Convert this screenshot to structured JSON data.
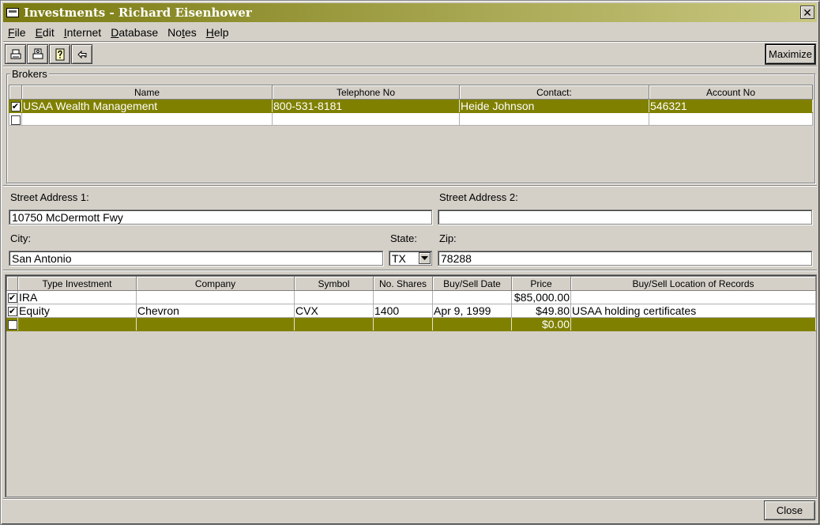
{
  "window": {
    "title": "Investments - Richard Eisenhower",
    "close_glyph": "✕"
  },
  "menu": [
    {
      "first": "F",
      "rest": "ile"
    },
    {
      "first": "E",
      "rest": "dit"
    },
    {
      "first": "I",
      "rest": "nternet"
    },
    {
      "first": "D",
      "rest": "atabase"
    },
    {
      "pre": "No",
      "first": "t",
      "rest": "es"
    },
    {
      "first": "H",
      "rest": "elp"
    }
  ],
  "toolbar": {
    "icons": [
      "print-icon",
      "print-preview-icon",
      "help-icon",
      "back-arrow-icon"
    ],
    "maximize_label": "Maximize"
  },
  "brokers": {
    "group_label": "Brokers",
    "columns": [
      "Name",
      "Telephone No",
      "Contact:",
      "Account No"
    ],
    "rows": [
      {
        "checked": "✔",
        "name": "USAA Wealth Management",
        "phone": "800-531-8181",
        "contact": "Heide Johnson",
        "account": "546321"
      },
      {
        "checked": "",
        "name": "",
        "phone": "",
        "contact": "",
        "account": ""
      }
    ]
  },
  "address": {
    "street1_label": "Street Address 1:",
    "street1_value": "10750 McDermott Fwy",
    "street2_label": "Street Address 2:",
    "street2_value": "",
    "city_label": "City:",
    "city_value": "San Antonio",
    "state_label": "State:",
    "state_value": "TX",
    "zip_label": "Zip:",
    "zip_value": "78288"
  },
  "investments": {
    "columns": [
      "Type Investment",
      "Company",
      "Symbol",
      "No. Shares",
      "Buy/Sell Date",
      "Price",
      "Buy/Sell  Location of Records"
    ],
    "rows": [
      {
        "checked": "✔",
        "type": "IRA",
        "company": "",
        "symbol": "",
        "shares": "",
        "date": "",
        "price": "$85,000.00",
        "location": ""
      },
      {
        "checked": "✔",
        "type": "Equity",
        "company": "Chevron",
        "symbol": "CVX",
        "shares": "1400",
        "date": "Apr 9, 1999",
        "price": "$49.80",
        "location": "USAA holding certificates"
      },
      {
        "checked": "",
        "type": "",
        "company": "",
        "symbol": "",
        "shares": "",
        "date": "",
        "price": "$0.00",
        "location": ""
      }
    ]
  },
  "footer": {
    "close_label": "Close"
  },
  "colors": {
    "selection": "#808000",
    "title_start": "#7a7a10",
    "title_end": "#c9c882"
  }
}
